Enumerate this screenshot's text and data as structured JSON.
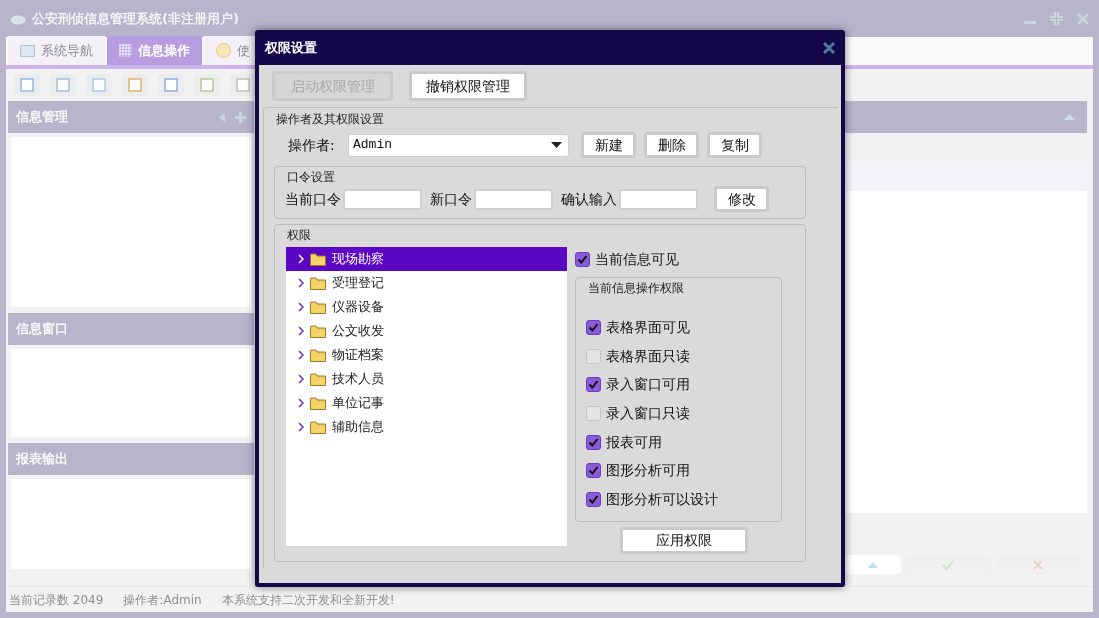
{
  "window": {
    "title": "公安刑侦信息管理系统(非注册用户)"
  },
  "tabs": [
    {
      "label": "系统导航",
      "selected": false
    },
    {
      "label": "信息操作",
      "selected": true
    },
    {
      "label": "使",
      "selected": false
    }
  ],
  "panels": [
    {
      "title": "信息管理"
    },
    {
      "title": "信息窗口"
    },
    {
      "title": "报表输出"
    }
  ],
  "status_bar": [
    "当前记录数 2049",
    "操作者:Admin",
    "本系统支持二次开发和全新开发!"
  ],
  "dialog": {
    "title": "权限设置",
    "buttons": [
      {
        "label": "启动权限管理",
        "disabled": true
      },
      {
        "label": "撤销权限管理",
        "disabled": false
      }
    ],
    "operator_group": {
      "title": "操作者及其权限设置",
      "label": "操作者:",
      "value": "Admin",
      "buttons": [
        "新建",
        "删除",
        "复制"
      ]
    },
    "password_group": {
      "title": "口令设置",
      "fields": [
        {
          "label": "当前口令"
        },
        {
          "label": "新口令"
        },
        {
          "label": "确认输入"
        }
      ],
      "button": "修改"
    },
    "permissions": {
      "title": "权限",
      "tree": [
        {
          "label": "现场勘察",
          "selected": true
        },
        {
          "label": "受理登记",
          "selected": false
        },
        {
          "label": "仪器设备",
          "selected": false
        },
        {
          "label": "公文收发",
          "selected": false
        },
        {
          "label": "物证档案",
          "selected": false
        },
        {
          "label": "技术人员",
          "selected": false
        },
        {
          "label": "单位记事",
          "selected": false
        },
        {
          "label": "辅助信息",
          "selected": false
        }
      ],
      "visible": {
        "label": "当前信息可见",
        "checked": true
      },
      "ops_title": "当前信息操作权限",
      "ops": [
        {
          "label": "表格界面可见",
          "checked": true
        },
        {
          "label": "表格界面只读",
          "checked": false
        },
        {
          "label": "录入窗口可用",
          "checked": true
        },
        {
          "label": "录入窗口只读",
          "checked": false
        },
        {
          "label": "报表可用",
          "checked": true
        },
        {
          "label": "图形分析可用",
          "checked": true
        },
        {
          "label": "图形分析可以设计",
          "checked": true
        }
      ],
      "apply": "应用权限"
    }
  }
}
